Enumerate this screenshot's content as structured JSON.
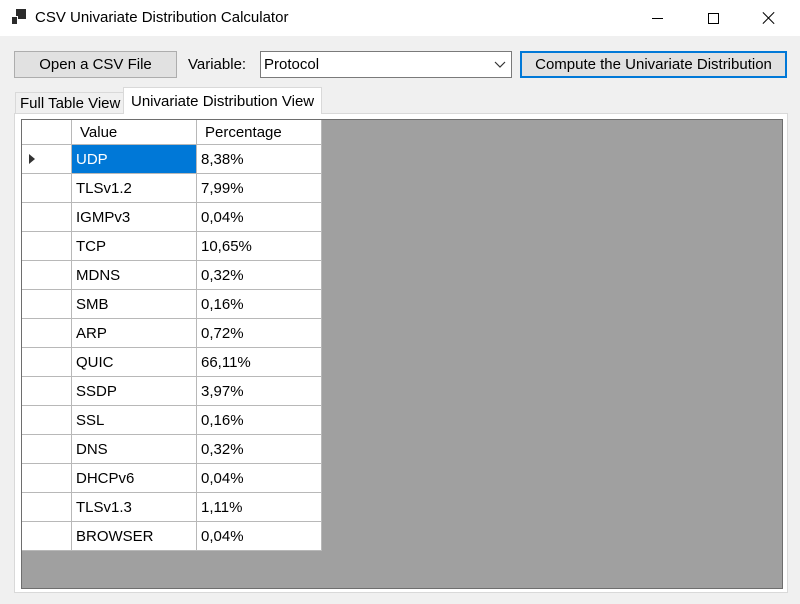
{
  "window": {
    "title": "CSV Univariate Distribution Calculator"
  },
  "toolbar": {
    "open_label": "Open a CSV File",
    "variable_label": "Variable:",
    "variable_value": "Protocol",
    "compute_label": "Compute the Univariate Distribution"
  },
  "tabs": [
    {
      "label": "Full Table View",
      "selected": false
    },
    {
      "label": "Univariate Distribution View",
      "selected": true
    }
  ],
  "table": {
    "columns": [
      "Value",
      "Percentage"
    ],
    "rows": [
      {
        "value": "UDP",
        "percentage": "8,38%"
      },
      {
        "value": "TLSv1.2",
        "percentage": "7,99%"
      },
      {
        "value": "IGMPv3",
        "percentage": "0,04%"
      },
      {
        "value": "TCP",
        "percentage": "10,65%"
      },
      {
        "value": "MDNS",
        "percentage": "0,32%"
      },
      {
        "value": "SMB",
        "percentage": "0,16%"
      },
      {
        "value": "ARP",
        "percentage": "0,72%"
      },
      {
        "value": "QUIC",
        "percentage": "66,11%"
      },
      {
        "value": "SSDP",
        "percentage": "3,97%"
      },
      {
        "value": "SSL",
        "percentage": "0,16%"
      },
      {
        "value": "DNS",
        "percentage": "0,32%"
      },
      {
        "value": "DHCPv6",
        "percentage": "0,04%"
      },
      {
        "value": "TLSv1.3",
        "percentage": "1,11%"
      },
      {
        "value": "BROWSER",
        "percentage": "0,04%"
      }
    ],
    "selected_row": 0
  },
  "colors": {
    "selection": "#0078d7",
    "grid_background": "#a0a0a0",
    "client_background": "#f0f0f0"
  },
  "icons": {
    "app": "app-window-icon",
    "minimize": "minimize-icon",
    "maximize": "maximize-icon",
    "close": "close-icon",
    "dropdown": "chevron-down-icon",
    "row_pointer": "row-pointer-icon"
  }
}
